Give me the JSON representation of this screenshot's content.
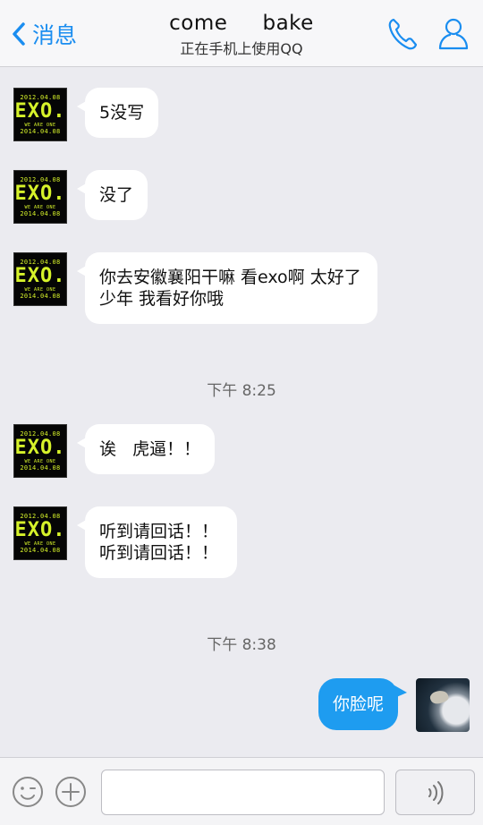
{
  "header": {
    "back_label": "消息",
    "title": "come     bake",
    "subtitle": "正在手机上使用QQ",
    "icons": [
      "chevron-left-icon",
      "phone-icon",
      "profile-icon"
    ]
  },
  "avatar_text": {
    "date_top": "2012.04.08",
    "logo": "EXO.",
    "slogan": "WE ARE ONE",
    "date_bottom": "2014.04.08"
  },
  "messages": [
    {
      "type": "in",
      "text": "5没写"
    },
    {
      "type": "in",
      "text": "没了"
    },
    {
      "type": "in",
      "text": "你去安徽襄阳干嘛  看exo啊  太好了 少年  我看好你哦"
    },
    {
      "type": "time",
      "text": "下午 8:25"
    },
    {
      "type": "in",
      "text": "诶   虎逼！！"
    },
    {
      "type": "in",
      "text": "听到请回话！！听到请回话！！"
    },
    {
      "type": "time",
      "text": "下午 8:38"
    },
    {
      "type": "out",
      "text": "你脸呢"
    }
  ],
  "inputbar": {
    "text_value": "",
    "icons": [
      "emoji-icon",
      "plus-icon",
      "voice-icon"
    ]
  },
  "colors": {
    "accent": "#1a8df0",
    "outgoing_bubble": "#1e9cf0",
    "background": "#ebebf0",
    "incoming_bubble": "#ffffff"
  }
}
